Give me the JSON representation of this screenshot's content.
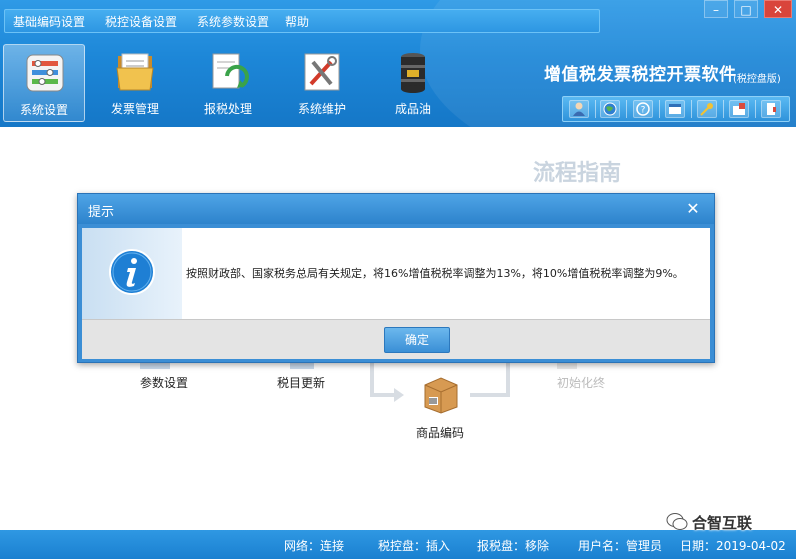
{
  "menu": {
    "items": [
      "基础编码设置",
      "税控设备设置",
      "系统参数设置",
      "帮助"
    ]
  },
  "window_controls": {
    "minimize": "–",
    "maximize": "□",
    "close": "✕"
  },
  "toolbar": {
    "items": [
      {
        "label": "系统设置",
        "icon": "settings-panel-icon",
        "active": true
      },
      {
        "label": "发票管理",
        "icon": "folder-icon",
        "active": false
      },
      {
        "label": "报税处理",
        "icon": "tax-report-icon",
        "active": false
      },
      {
        "label": "系统维护",
        "icon": "tools-icon",
        "active": false
      },
      {
        "label": "成品油",
        "icon": "oil-barrel-icon",
        "active": false
      }
    ]
  },
  "app": {
    "title": "增值税发票税控开票软件",
    "subtitle": "(税控盘版)"
  },
  "quick_bar": {
    "icons": [
      "user-icon",
      "globe-icon",
      "help-icon",
      "window-icon",
      "key-icon",
      "lock-icon",
      "exit-icon"
    ]
  },
  "guide": {
    "title": "流程指南",
    "steps": [
      "参数设置",
      "税目更新",
      "商品编码",
      "初始化终"
    ]
  },
  "dialog": {
    "title": "提示",
    "close": "✕",
    "message": "按照财政部、国家税务总局有关规定，将16%增值税税率调整为13%，将10%增值税税率调整为9%。",
    "ok_label": "确定"
  },
  "status": {
    "network": "网络：连接",
    "tax_disk": "税控盘：插入",
    "report_disk": "报税盘：移除",
    "user": "用户名：管理员",
    "date": "日期：2019-04-02"
  },
  "watermark": {
    "text": "合智互联"
  },
  "colors": {
    "header_blue": "#1d87d8",
    "dialog_blue": "#3b8ed5",
    "status_blue": "#1a80d0"
  }
}
